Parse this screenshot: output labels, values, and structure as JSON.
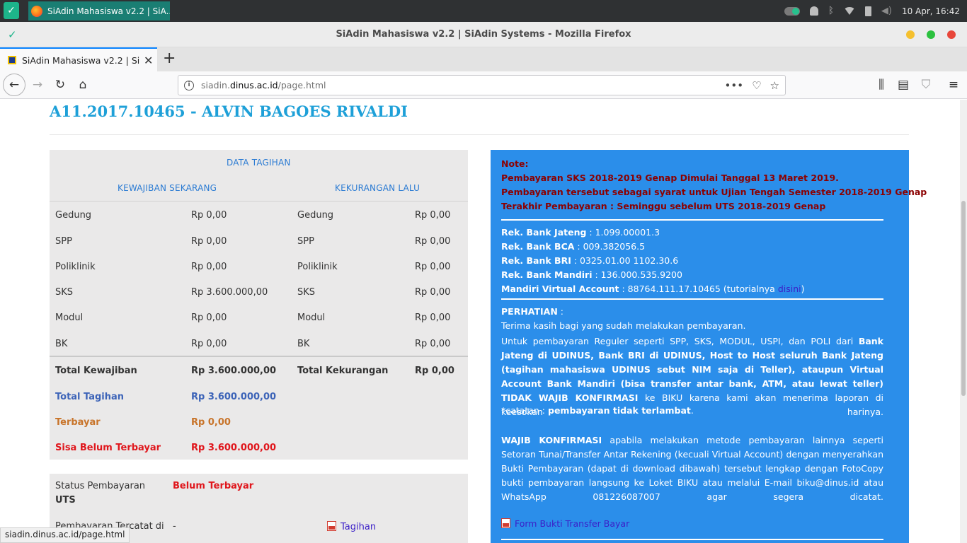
{
  "os_panel": {
    "task_title": "SiAdin Mahasiswa v2.2 | SiA...",
    "datetime": "10 Apr, 16:42"
  },
  "window": {
    "title": "SiAdin Mahasiswa v2.2 | SiAdin Systems - Mozilla Firefox"
  },
  "tab": {
    "label": "SiAdin Mahasiswa v2.2 | SiAdin Systems"
  },
  "nav": {
    "url_prefix": "siadin.",
    "url_domain": "dinus.ac.id",
    "url_path": "/page.html"
  },
  "page": {
    "student_name": "A11.2017.10465 - ALVIN BAGOES RIVALDI",
    "bill": {
      "title": "DATA TAGIHAN",
      "col_now": "KEWAJIBAN SEKARANG",
      "col_past": "KEKURANGAN LALU",
      "rows": [
        {
          "now_label": "Gedung",
          "now_value": "Rp 0,00",
          "past_label": "Gedung",
          "past_value": "Rp 0,00"
        },
        {
          "now_label": "SPP",
          "now_value": "Rp 0,00",
          "past_label": "SPP",
          "past_value": "Rp 0,00"
        },
        {
          "now_label": "Poliklinik",
          "now_value": "Rp 0,00",
          "past_label": "Poliklinik",
          "past_value": "Rp 0,00"
        },
        {
          "now_label": "SKS",
          "now_value": "Rp 3.600.000,00",
          "past_label": "SKS",
          "past_value": "Rp 0,00"
        },
        {
          "now_label": "Modul",
          "now_value": "Rp 0,00",
          "past_label": "Modul",
          "past_value": "Rp 0,00"
        },
        {
          "now_label": "BK",
          "now_value": "Rp 0,00",
          "past_label": "BK",
          "past_value": "Rp 0,00"
        }
      ],
      "total_now_label": "Total Kewajiban",
      "total_now_value": "Rp 3.600.000,00",
      "total_past_label": "Total Kekurangan",
      "total_past_value": "Rp 0,00",
      "total_bill_label": "Total Tagihan",
      "total_bill_value": "Rp 3.600.000,00",
      "paid_label": "Terbayar",
      "paid_value": "Rp 0,00",
      "unpaid_label": "Sisa Belum Terbayar",
      "unpaid_value": "Rp 3.600.000,00"
    },
    "status": {
      "label_line1": "Status Pembayaran",
      "label_line2": "UTS",
      "value": "Belum Terbayar",
      "recorded_label": "Pembayaran Tercatat di",
      "recorded_value": "-",
      "bill_link": "Tagihan"
    },
    "note": {
      "title": "Note:",
      "line1": "Pembayaran SKS 2018-2019 Genap Dimulai Tanggal 13 Maret 2019.",
      "line2": "Pembayaran tersebut sebagai syarat untuk Ujian Tengah Semester 2018-2019 Genap",
      "line3": "Terakhir Pembayaran : Seminggu sebelum UTS 2018-2019 Genap",
      "banks": [
        {
          "label": "Rek. Bank Jateng",
          "value": " : 1.099.00001.3"
        },
        {
          "label": "Rek. Bank BCA",
          "value": " : 009.382056.5"
        },
        {
          "label": "Rek. Bank BRI",
          "value": " : 0325.01.00 1102.30.6"
        },
        {
          "label": "Rek. Bank Mandiri",
          "value": " : 136.000.535.9200"
        }
      ],
      "va_label": "Mandiri Virtual Account",
      "va_value": " : 88764.111.17.10465 (tutorialnya ",
      "va_link": "disini",
      "va_close": ")",
      "perhatian_title": "PERHATIAN",
      "perhatian_colon": " :",
      "thanks": "Terima kasih bagi yang sudah melakukan pembayaran.",
      "p1_a": "Untuk pembayaran Reguler seperti SPP, SKS, MODUL, USPI, dan POLI dari ",
      "p1_b": "Bank Jateng di UDINUS, Bank BRI di UDINUS, Host to Host seluruh Bank Jateng (tagihan mahasiswa UDINUS sebut NIM saja di Teller), ataupun Virtual Account Bank Mandiri (bisa transfer antar bank, ATM, atau lewat teller) TIDAK WAJIB KONFIRMASI",
      "p1_c": " ke BIKU karena kami akan menerima laporan di keesokan harinya.",
      "catatan_a": "*catatan : ",
      "catatan_b": "pembayaran tidak terlambat",
      "catatan_c": ".",
      "p2_a": "WAJIB KONFIRMASI",
      "p2_b": " apabila melakukan metode pembayaran lainnya seperti Setoran Tunai/Transfer Antar Rekening (kecuali Virtual Account) dengan menyerahkan Bukti Pembayaran (dapat di download dibawah) tersebut lengkap dengan FotoCopy bukti pembayaran langsung ke Loket BIKU atau melalui E-mail biku@dinus.id atau WhatsApp 081226087007 agar segera dicatat.",
      "form_link": "Form Bukti Transfer Bayar"
    }
  },
  "statusbar": {
    "text": "siadin.dinus.ac.id/page.html"
  },
  "colors": {
    "accent_blue": "#1ea0d8",
    "note_bg": "#2b8eea",
    "warning_red": "#e0161c"
  }
}
